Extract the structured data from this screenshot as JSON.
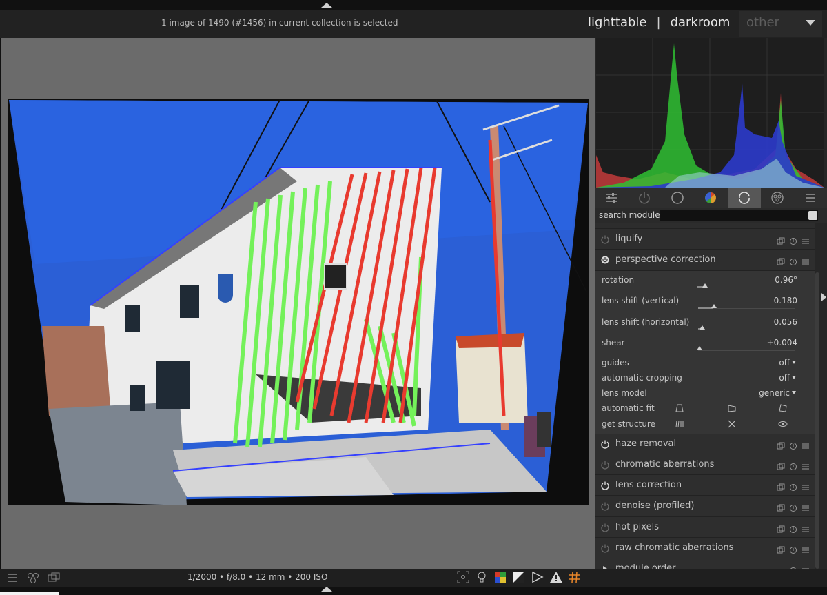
{
  "header": {
    "status": "1 image of 1490 (#1456) in current collection is selected",
    "views": [
      "lighttable",
      "darkroom"
    ],
    "other_label": "other"
  },
  "histogram": {
    "channels": [
      "red",
      "green",
      "blue"
    ]
  },
  "module_tabs": [
    "quick-access-icon",
    "power-icon",
    "circle-icon",
    "color-wheel-icon",
    "correct-icon",
    "effects-icon",
    "menu-icon"
  ],
  "search": {
    "label": "search module",
    "value": ""
  },
  "modules_top": [
    {
      "name": "liquify",
      "enabled": false
    }
  ],
  "perspective": {
    "name": "perspective correction",
    "enabled": true,
    "sliders": [
      {
        "label": "rotation",
        "value": "0.96°"
      },
      {
        "label": "lens shift (vertical)",
        "value": "0.180"
      },
      {
        "label": "lens shift (horizontal)",
        "value": "0.056"
      },
      {
        "label": "shear",
        "value": "+0.004"
      }
    ],
    "combos": [
      {
        "label": "guides",
        "value": "off"
      },
      {
        "label": "automatic cropping",
        "value": "off"
      },
      {
        "label": "lens model",
        "value": "generic"
      }
    ],
    "automatic_fit_label": "automatic fit",
    "get_structure_label": "get structure"
  },
  "modules_bottom": [
    {
      "name": "haze removal",
      "enabled": true
    },
    {
      "name": "chromatic aberrations",
      "enabled": false
    },
    {
      "name": "lens correction",
      "enabled": true
    },
    {
      "name": "denoise (profiled)",
      "enabled": false
    },
    {
      "name": "hot pixels",
      "enabled": false
    },
    {
      "name": "raw chromatic aberrations",
      "enabled": false
    }
  ],
  "module_order": {
    "label": "module order"
  },
  "footer": {
    "exif": "1/2000 • f/8.0 • 12 mm • 200 ISO"
  },
  "colors": {
    "accent_active_tab": "#575757",
    "sky": "#1f5ad8",
    "guide_green": "#74f15a",
    "guide_red": "#e83a2f"
  }
}
